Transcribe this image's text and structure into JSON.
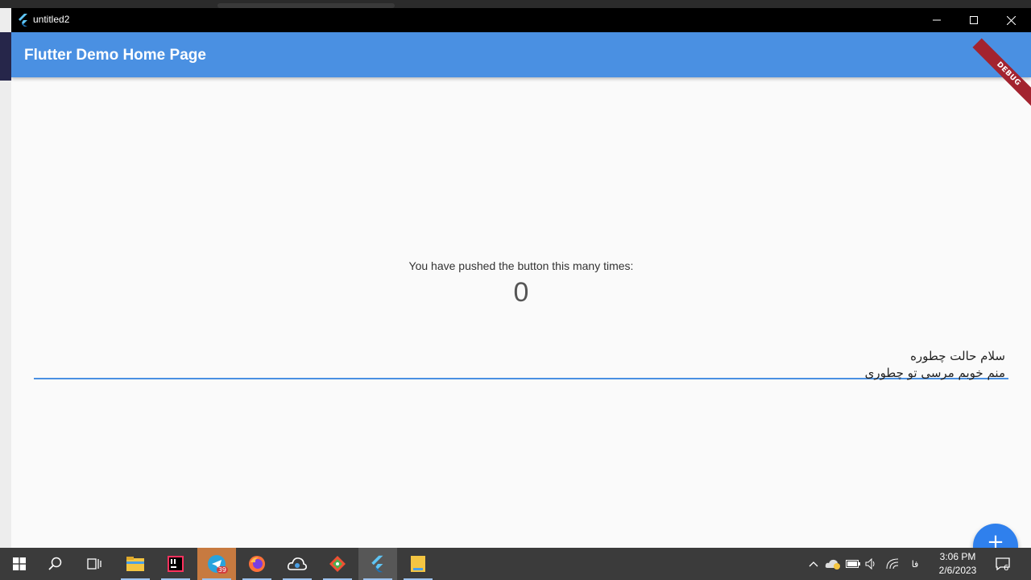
{
  "window": {
    "title": "untitled2"
  },
  "appbar": {
    "title": "Flutter Demo Home Page",
    "color": "#4a90e2"
  },
  "debug_banner": {
    "label": "DEBUG"
  },
  "counter": {
    "label": "You have pushed the button this many times:",
    "value": "0"
  },
  "text_field": {
    "line1": "سلام حالت چطوره",
    "line2": "منم خوبم مرسی تو چطوری"
  },
  "fab": {
    "icon": "add-icon",
    "label": "+"
  },
  "taskbar": {
    "items": [
      {
        "name": "start-icon"
      },
      {
        "name": "search-icon"
      },
      {
        "name": "task-view-icon"
      },
      {
        "name": "file-explorer-icon"
      },
      {
        "name": "intellij-icon"
      },
      {
        "name": "telegram-icon",
        "badge": "39"
      },
      {
        "name": "firefox-icon"
      },
      {
        "name": "cloud-app-icon"
      },
      {
        "name": "git-icon"
      },
      {
        "name": "flutter-icon"
      },
      {
        "name": "notes-icon"
      }
    ],
    "language": "فا",
    "time": "3:06 PM",
    "date": "2/6/2023",
    "notifications": "6"
  }
}
